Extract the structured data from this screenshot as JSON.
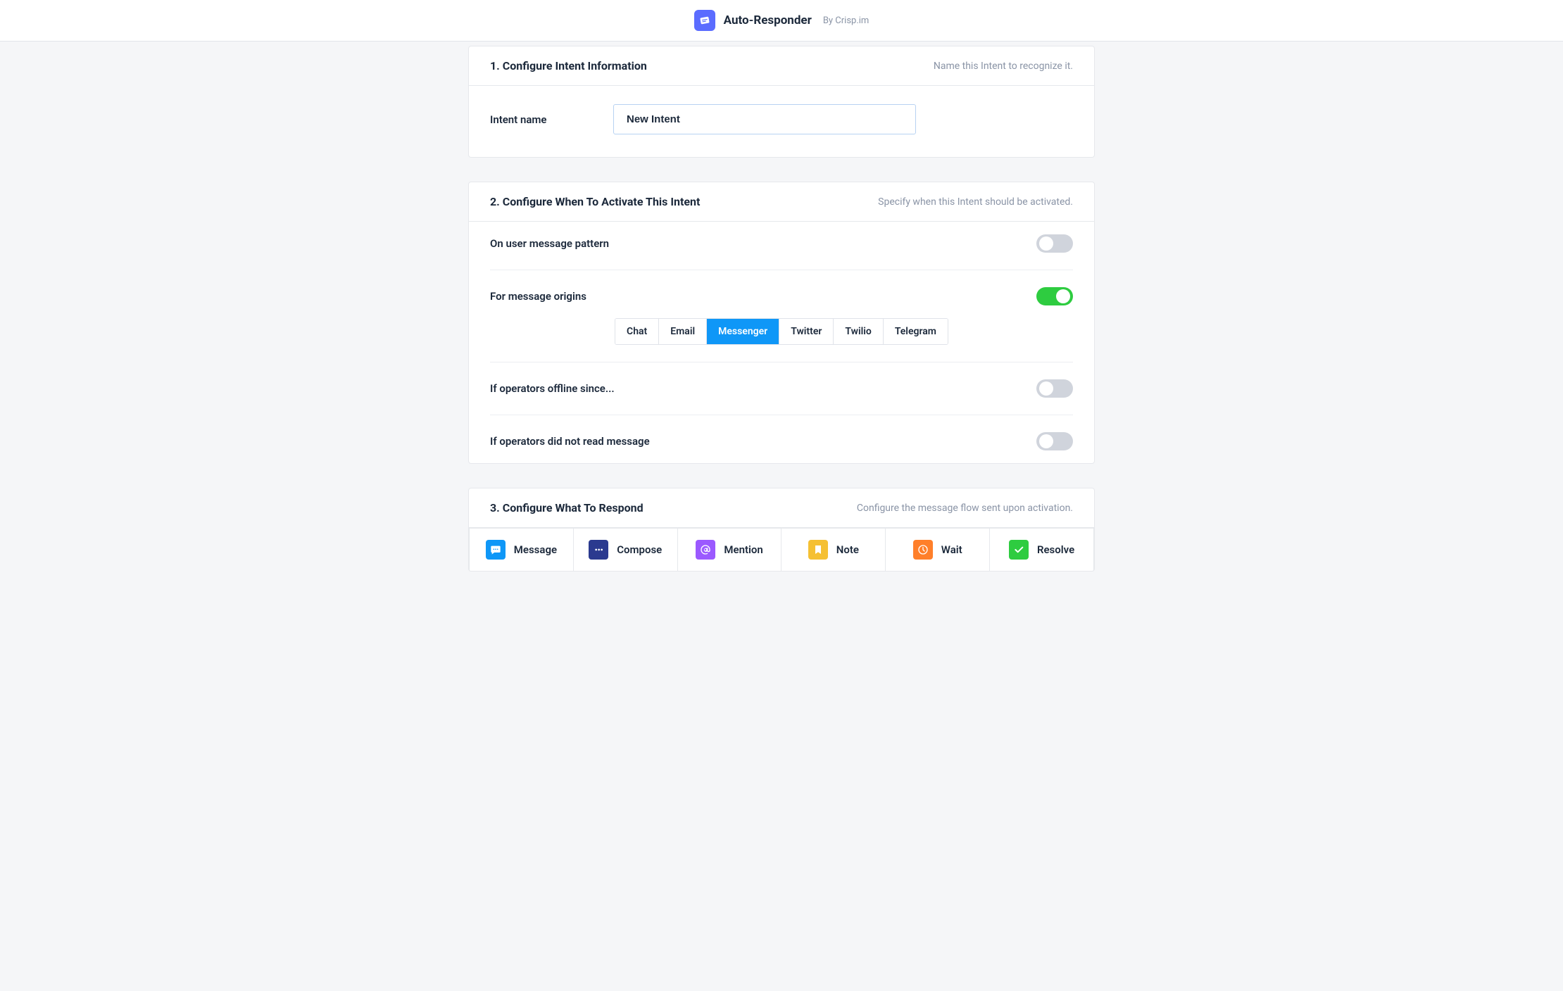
{
  "header": {
    "app_name": "Auto-Responder",
    "by_label": "By Crisp.im"
  },
  "section1": {
    "title": "1. Configure Intent Information",
    "hint": "Name this Intent to recognize it.",
    "intent_name_label": "Intent name",
    "intent_name_value": "New Intent"
  },
  "section2": {
    "title": "2. Configure When To Activate This Intent",
    "hint": "Specify when this Intent should be activated.",
    "pattern_label": "On user message pattern",
    "pattern_enabled": false,
    "origins_label": "For message origins",
    "origins_enabled": true,
    "origins": [
      {
        "label": "Chat",
        "active": false
      },
      {
        "label": "Email",
        "active": false
      },
      {
        "label": "Messenger",
        "active": true
      },
      {
        "label": "Twitter",
        "active": false
      },
      {
        "label": "Twilio",
        "active": false
      },
      {
        "label": "Telegram",
        "active": false
      }
    ],
    "offline_label": "If operators offline since...",
    "offline_enabled": false,
    "unread_label": "If operators did not read message",
    "unread_enabled": false
  },
  "section3": {
    "title": "3. Configure What To Respond",
    "hint": "Configure the message flow sent upon activation.",
    "actions": [
      {
        "name": "message",
        "label": "Message",
        "icon_class": "icon-message"
      },
      {
        "name": "compose",
        "label": "Compose",
        "icon_class": "icon-compose"
      },
      {
        "name": "mention",
        "label": "Mention",
        "icon_class": "icon-mention"
      },
      {
        "name": "note",
        "label": "Note",
        "icon_class": "icon-note"
      },
      {
        "name": "wait",
        "label": "Wait",
        "icon_class": "icon-wait"
      },
      {
        "name": "resolve",
        "label": "Resolve",
        "icon_class": "icon-resolve"
      }
    ]
  }
}
